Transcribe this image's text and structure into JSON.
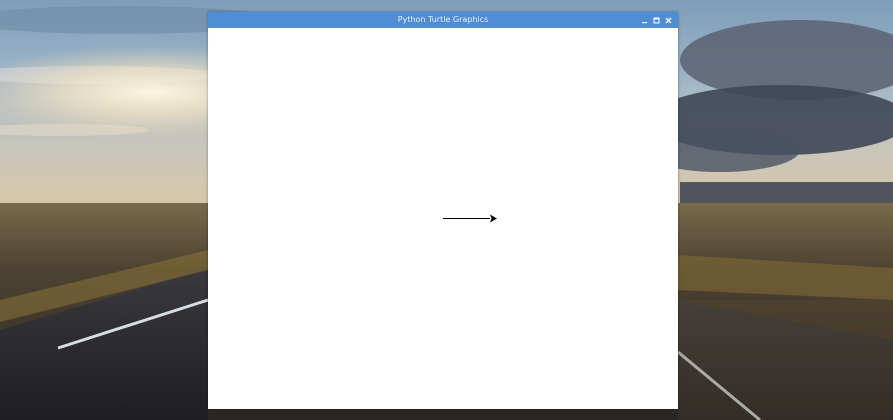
{
  "window": {
    "title": "Python Turtle Graphics"
  },
  "titlebar_buttons": [
    {
      "icon": "minimize-icon"
    },
    {
      "icon": "maximize-icon"
    },
    {
      "icon": "close-icon"
    }
  ],
  "colors": {
    "titlebar": "#4f8dd4",
    "canvas": "#ffffff",
    "turtle_line": "#000000"
  }
}
